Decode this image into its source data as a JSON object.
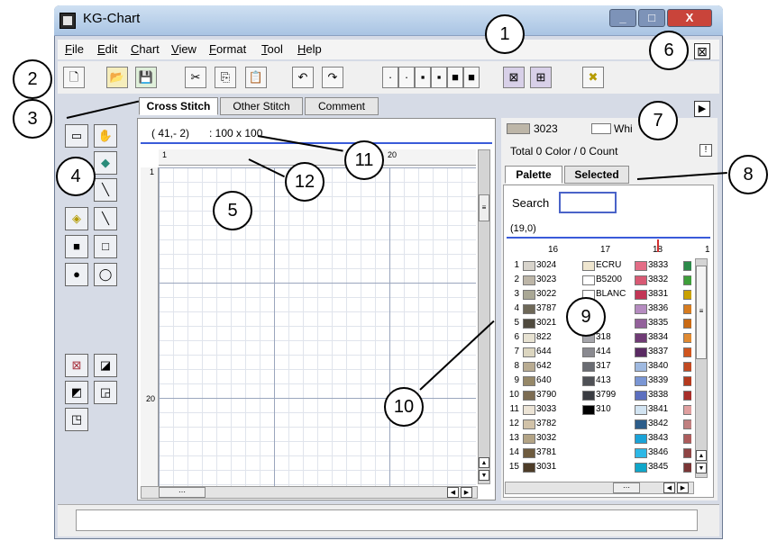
{
  "window": {
    "title": "KG-Chart"
  },
  "menu": [
    {
      "label": "File",
      "u": "F",
      "rest": "ile"
    },
    {
      "label": "Edit",
      "u": "E",
      "rest": "dit"
    },
    {
      "label": "Chart",
      "u": "C",
      "rest": "hart"
    },
    {
      "label": "View",
      "u": "V",
      "rest": "iew"
    },
    {
      "label": "Format",
      "u": "F",
      "rest": "ormat"
    },
    {
      "label": "Tool",
      "u": "T",
      "rest": "ool"
    },
    {
      "label": "Help",
      "u": "H",
      "rest": "elp"
    }
  ],
  "tabs": {
    "cross": "Cross Stitch",
    "other": "Other Stitch",
    "comment": "Comment"
  },
  "canvas": {
    "coords": "( 41,- 2)",
    "size": ": 100 x 100",
    "ruler_20": "20",
    "row_1": "1",
    "row_20": "20",
    "ruler_1": "1"
  },
  "color_bar": {
    "color1": "3023",
    "color2": "Whi",
    "total": "Total 0 Color / 0 Count",
    "btn": "!"
  },
  "palette_tabs": {
    "palette": "Palette",
    "selected": "Selected"
  },
  "search": {
    "label": "Search",
    "value": ""
  },
  "palette": {
    "pos": "(19,0)",
    "cols": [
      "16",
      "17",
      "18",
      "1"
    ],
    "rows": [
      {
        "n": "1",
        "a": "3024",
        "ac": "#d8d4cc",
        "b": "ECRU",
        "bc": "#efe6cf",
        "c": "3833",
        "cc": "#e36d86",
        "d": "#2c8a4a"
      },
      {
        "n": "2",
        "a": "3023",
        "ac": "#bdb6a8",
        "b": "B5200",
        "bc": "#ffffff",
        "c": "3832",
        "cc": "#d85a74",
        "d": "#3e9e3a"
      },
      {
        "n": "3",
        "a": "3022",
        "ac": "#a9a795",
        "b": "BLANC",
        "bc": "#ffffff",
        "c": "3831",
        "cc": "#c23656",
        "d": "#c9a100"
      },
      {
        "n": "4",
        "a": "3787",
        "ac": "#6e6858",
        "b": "",
        "bc": "",
        "c": "3836",
        "cc": "#b58cc0",
        "d": "#d77c1f"
      },
      {
        "n": "5",
        "a": "3021",
        "ac": "#4f4a3e",
        "b": "",
        "bc": "",
        "c": "3835",
        "cc": "#93619b",
        "d": "#c96a14"
      },
      {
        "n": "6",
        "a": "822",
        "ac": "#e7e2d2",
        "b": "318",
        "bc": "#a6a6ab",
        "c": "3834",
        "cc": "#6f3b75",
        "d": "#e08a32"
      },
      {
        "n": "7",
        "a": "644",
        "ac": "#dcd6c0",
        "b": "414",
        "bc": "#8a8a90",
        "c": "3837",
        "cc": "#5a2b63",
        "d": "#d0551e"
      },
      {
        "n": "8",
        "a": "642",
        "ac": "#b9ac92",
        "b": "317",
        "bc": "#6a6c72",
        "c": "3840",
        "cc": "#9fb9e0",
        "d": "#c24a22"
      },
      {
        "n": "9",
        "a": "640",
        "ac": "#968868",
        "b": "413",
        "bc": "#4f5156",
        "c": "3839",
        "cc": "#7a96d4",
        "d": "#b53a1e"
      },
      {
        "n": "10",
        "a": "3790",
        "ac": "#7c6c52",
        "b": "3799",
        "bc": "#3a3c42",
        "c": "3838",
        "cc": "#5c6fbf",
        "d": "#a82f2a"
      },
      {
        "n": "11",
        "a": "3033",
        "ac": "#ece4d6",
        "b": "310",
        "bc": "#000000",
        "c": "3841",
        "cc": "#d2e4f2",
        "d": "#e0a0a0"
      },
      {
        "n": "12",
        "a": "3782",
        "ac": "#d1c2a8",
        "b": "",
        "bc": "",
        "c": "3842",
        "cc": "#2c5d8a",
        "d": "#c08080"
      },
      {
        "n": "13",
        "a": "3032",
        "ac": "#b3a486",
        "b": "",
        "bc": "",
        "c": "3843",
        "cc": "#1aa3d8",
        "d": "#ad5c5c"
      },
      {
        "n": "14",
        "a": "3781",
        "ac": "#6e5b3e",
        "b": "",
        "bc": "",
        "c": "3846",
        "cc": "#2db8e6",
        "d": "#8e4444"
      },
      {
        "n": "15",
        "a": "3031",
        "ac": "#4d3c28",
        "b": "",
        "bc": "",
        "c": "3845",
        "cc": "#10a6c9",
        "d": "#7a3535"
      }
    ]
  },
  "callouts": [
    "1",
    "2",
    "3",
    "4",
    "5",
    "6",
    "7",
    "8",
    "9",
    "10",
    "11",
    "12"
  ],
  "toolbar_icons": {
    "new": "🗋",
    "open": "📂",
    "save": "💾",
    "cut": "✂",
    "copy": "⎘",
    "paste": "📋",
    "undo": "↶",
    "redo": "↷",
    "zoom1": "·",
    "zoom2": "·",
    "zoom3": "▪",
    "zoom4": "▪",
    "zoom5": "■",
    "zoom6": "■",
    "grid_a": "⊠",
    "grid_b": "⊞",
    "exit": "✖"
  },
  "window_buttons": {
    "min": "_",
    "max": "□",
    "close": "X"
  },
  "close_panel": "⊠",
  "collapse_panel": "▶",
  "scroll_glyphs": {
    "up": "▲",
    "down": "▼",
    "left": "◀",
    "right": "▶",
    "grip": "≡",
    "hgrip": "⋯"
  },
  "tools": {
    "select": "▭",
    "pan": "✋",
    "fill": "◆",
    "pen": "╲",
    "bucket": "◈",
    "line": "╲",
    "rect_fill": "■",
    "rect": "□",
    "ellipse_fill": "●",
    "lasso": "◯",
    "stitch_full": "⊠",
    "stitch_half_a": "◪",
    "stitch_half_b": "◩",
    "stitch_quarter": "◲",
    "stitch_quarter_b": "◳"
  },
  "colors": {
    "accent": "#3a5bd9",
    "titlebar": "#a9c4e3",
    "close_btn": "#c9443a"
  }
}
